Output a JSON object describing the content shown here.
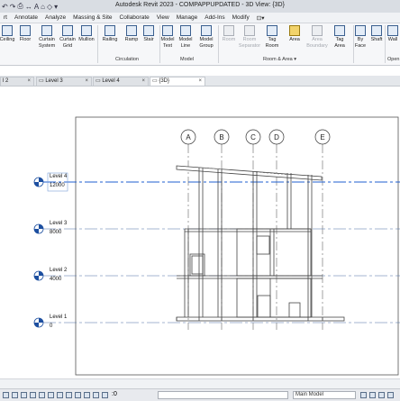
{
  "app": {
    "title": "Autodesk Revit 2023 - COMPAPPUPDATED - 3D View: {3D}"
  },
  "menu": {
    "items": [
      "rt",
      "Annotate",
      "Analyze",
      "Massing & Site",
      "Collaborate",
      "View",
      "Manage",
      "Add-Ins",
      "Modify",
      "⊡▾"
    ]
  },
  "ribbon": {
    "tools": [
      "Ceiling",
      "Floor",
      "Curtain\nSystem",
      "Curtain\nGrid",
      "Mullion",
      "Railing",
      "Ramp",
      "Stair",
      "Model\nText",
      "Model\nLine",
      "Model\nGroup",
      "Room",
      "Room\nSeparator",
      "Tag\nRoom",
      "Area",
      "Area\nBoundary",
      "Tag\nArea",
      "By\nFace",
      "Shaft",
      "Wall"
    ],
    "panels": [
      "Circulation",
      "Model",
      "Room & Area ▾",
      "Open"
    ]
  },
  "tabs": [
    {
      "label": "l 2",
      "active": false
    },
    {
      "label": "Level 3",
      "active": false
    },
    {
      "label": "Level 4",
      "active": false
    },
    {
      "label": "{3D}",
      "active": true
    }
  ],
  "grids": [
    "A",
    "B",
    "C",
    "D",
    "E"
  ],
  "levels": [
    {
      "name": "Level 4",
      "elev": "12000",
      "selected": true
    },
    {
      "name": "Level 3",
      "elev": "8000",
      "selected": false
    },
    {
      "name": "Level 2",
      "elev": "4000",
      "selected": false
    },
    {
      "name": "Level 1",
      "elev": "0",
      "selected": false
    }
  ],
  "bottom": {
    "zoom": ":0",
    "model": "Main Model"
  },
  "colors": {
    "level_line": "#4a6fa5",
    "selected_level": "#1f5fd0",
    "symbol": "#1d4fa0"
  }
}
